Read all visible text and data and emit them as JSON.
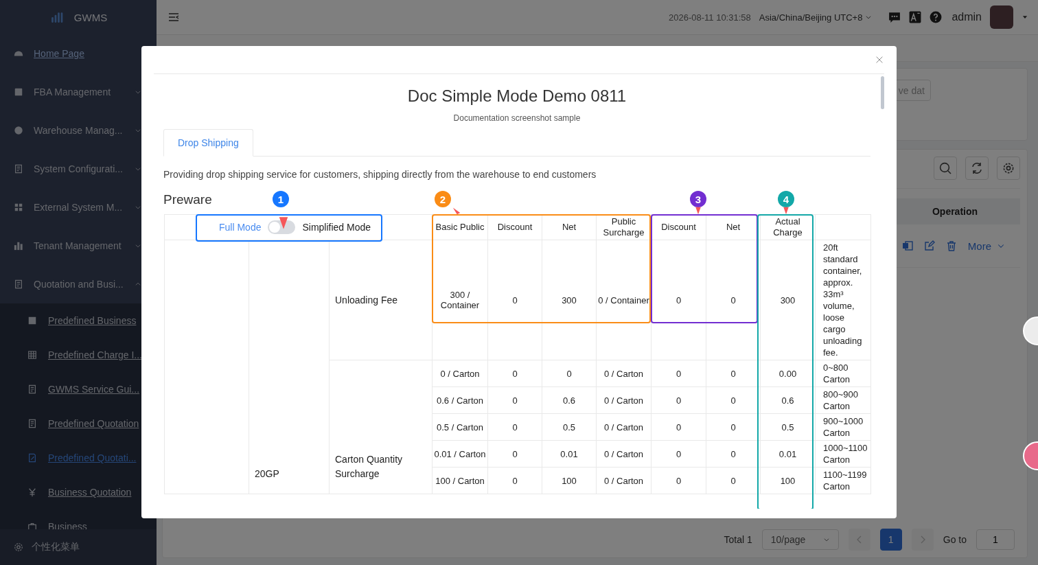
{
  "sidebar": {
    "logo": "GWMS",
    "items": [
      {
        "label": "Home Page",
        "kind": "link"
      },
      {
        "label": "FBA Management",
        "kind": "group",
        "expanded": false
      },
      {
        "label": "Warehouse Manag...",
        "kind": "group",
        "expanded": false
      },
      {
        "label": "System Configurati...",
        "kind": "group",
        "expanded": false
      },
      {
        "label": "External System M...",
        "kind": "group",
        "expanded": false
      },
      {
        "label": "Tenant Management",
        "kind": "group",
        "expanded": false
      },
      {
        "label": "Quotation and Busi...",
        "kind": "group",
        "expanded": true,
        "children": [
          {
            "label": "Predefined Business",
            "selected": false
          },
          {
            "label": "Predefined Charge I...",
            "selected": false
          },
          {
            "label": "GWMS Service Gui...",
            "selected": false
          },
          {
            "label": "Predefined Quotation",
            "selected": false
          },
          {
            "label": "Predefined Quotati...",
            "selected": true
          },
          {
            "label": "Business Quotation",
            "selected": false
          },
          {
            "label": "Business",
            "selected": false
          }
        ]
      }
    ],
    "footer": "个性化菜单"
  },
  "header": {
    "datetime": "2026-08-11 10:31:58",
    "timezone": "Asia/China/Beijing UTC+8",
    "user": "admin"
  },
  "background": {
    "filter_button": "ve dat",
    "operation_header": "Operation",
    "more_action": "More",
    "pagination": {
      "total": "Total 1",
      "page_size": "10/page",
      "pages": [
        {
          "label": "1",
          "selected": true
        }
      ],
      "goto_label": "Go to",
      "goto_value": "1"
    }
  },
  "modal": {
    "title": "Doc Simple Mode Demo 0811",
    "subtitle": "Documentation screenshot sample",
    "tabs": [
      {
        "label": "Drop Shipping",
        "selected": true
      }
    ],
    "description": "Providing drop shipping service for customers, shipping directly from the warehouse to end customers",
    "section": "Preware",
    "mode_switch": {
      "left_label": "Full Mode",
      "right_label": "Simplified Mode",
      "on": false
    },
    "columns": [
      "Basic Public",
      "Discount",
      "Net",
      "Public Surcharge",
      "Discount",
      "Net",
      "Actual Charge"
    ],
    "groups": [
      {
        "container": "20GP",
        "charges": [
          {
            "name": "Unloading Fee",
            "rows": [
              {
                "cells": [
                  "300 / Container",
                  "0",
                  "300",
                  "0 / Container",
                  "0",
                  "0",
                  "300"
                ],
                "remark": "20ft standard container, approx. 33m³ volume, loose cargo unloading fee."
              }
            ]
          },
          {
            "name": "Carton Quantity Surcharge",
            "rows": [
              {
                "cells": [
                  "0 / Carton",
                  "0",
                  "0",
                  "0 / Carton",
                  "0",
                  "0",
                  "0.00"
                ],
                "remark": "0~800 Carton"
              },
              {
                "cells": [
                  "0.6 / Carton",
                  "0",
                  "0.6",
                  "0 / Carton",
                  "0",
                  "0",
                  "0.6"
                ],
                "remark": "800~900 Carton"
              },
              {
                "cells": [
                  "0.5 / Carton",
                  "0",
                  "0.5",
                  "0 / Carton",
                  "0",
                  "0",
                  "0.5"
                ],
                "remark": "900~1000 Carton"
              },
              {
                "cells": [
                  "0.01 / Carton",
                  "0",
                  "0.01",
                  "0 / Carton",
                  "0",
                  "0",
                  "0.01"
                ],
                "remark": "1000~1100 Carton"
              },
              {
                "cells": [
                  "100 / Carton",
                  "0",
                  "100",
                  "0 / Carton",
                  "0",
                  "0",
                  "100"
                ],
                "remark": "1100~1199 Carton"
              }
            ]
          }
        ]
      }
    ],
    "annotations": [
      {
        "number": "1",
        "color": "#1677ff"
      },
      {
        "number": "2",
        "color": "#fa8c16"
      },
      {
        "number": "3",
        "color": "#722ed1"
      },
      {
        "number": "4",
        "color": "#13a8a8"
      }
    ]
  }
}
